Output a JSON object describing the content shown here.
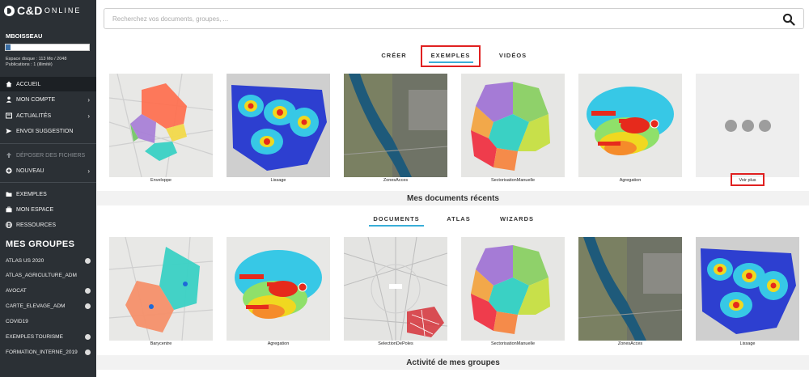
{
  "app": {
    "brand": "C&D",
    "brand_suffix": "ONLINE"
  },
  "user": {
    "name": "MBOISSEAU",
    "disk_usage": "Espace disque : 113 Mo / 2048",
    "publications": "Publications : 1 (illimité)",
    "quota_fraction": 0.06
  },
  "sidebar": {
    "nav": [
      {
        "label": "ACCUEIL",
        "icon": "home-icon",
        "active": true,
        "chevron": false
      },
      {
        "label": "MON COMPTE",
        "icon": "user-icon",
        "chevron": true
      },
      {
        "label": "ACTUALITÉS",
        "icon": "news-icon",
        "chevron": true
      },
      {
        "label": "ENVOI SUGGESTION",
        "icon": "send-icon",
        "chevron": false
      },
      {
        "label": "DÉPOSER DES FICHIERS",
        "icon": "upload-icon",
        "disabled": true,
        "chevron": false
      },
      {
        "label": "NOUVEAU",
        "icon": "plus-icon",
        "chevron": true
      },
      {
        "label": "EXEMPLES",
        "icon": "folder-icon",
        "chevron": false
      },
      {
        "label": "MON ESPACE",
        "icon": "briefcase-icon",
        "chevron": false
      },
      {
        "label": "RESSOURCES",
        "icon": "globe-icon",
        "chevron": false
      }
    ],
    "groups_title": "MES GROUPES",
    "groups": [
      {
        "label": "ATLAS US 2020",
        "gear": true
      },
      {
        "label": "ATLAS_AGRICULTURE_ADM",
        "gear": false
      },
      {
        "label": "AVOCAT",
        "gear": true
      },
      {
        "label": "CARTE_ELEVAGE_ADM",
        "gear": true
      },
      {
        "label": "COVID19",
        "gear": false
      },
      {
        "label": "EXEMPLES TOURISME",
        "gear": true
      },
      {
        "label": "FORMATION_INTERNE_2019",
        "gear": true
      }
    ]
  },
  "search": {
    "placeholder": "Recherchez vos documents, groupes, ..."
  },
  "top_tabs": [
    "CRÉER",
    "EXEMPLES",
    "VIDÉOS"
  ],
  "examples": {
    "items": [
      "Enveloppe",
      "Lissage",
      "ZonesAcces",
      "SectorisationManuelle",
      "Agregation"
    ],
    "see_more": "Voir plus"
  },
  "recent": {
    "title": "Mes documents récents",
    "tabs": [
      "DOCUMENTS",
      "ATLAS",
      "WIZARDS"
    ],
    "items": [
      "Barycentre",
      "Agregation",
      "SelectionDePoles",
      "SectorisationManuelle",
      "ZonesAcces",
      "Lissage"
    ]
  },
  "activity_title": "Activité de mes groupes",
  "colors": {
    "accent": "#3aaed8",
    "sidebar_bg": "#2b3035",
    "highlight": "#e02020"
  }
}
